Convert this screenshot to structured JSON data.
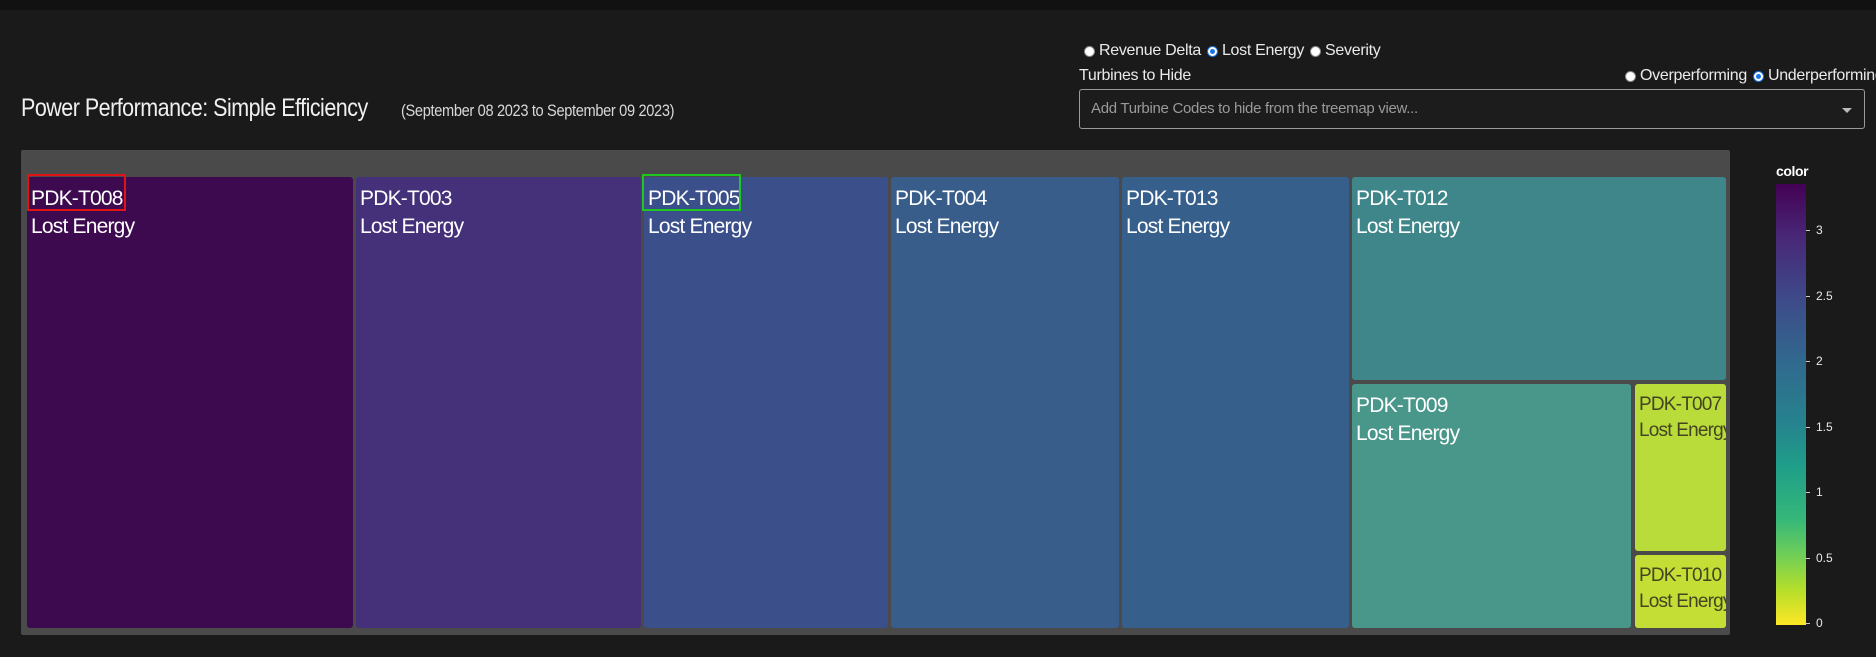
{
  "header": {
    "title": "Power Performance: Simple Efficiency",
    "subtitle": "(September 08 2023 to September 09 2023)"
  },
  "metric_selector": {
    "options": [
      {
        "label": "Revenue Delta",
        "checked": false
      },
      {
        "label": "Lost Energy",
        "checked": true
      },
      {
        "label": "Severity",
        "checked": false
      }
    ]
  },
  "performance_selector": {
    "options": [
      {
        "label": "Overperforming",
        "checked": false
      },
      {
        "label": "Underperforming",
        "checked": true
      }
    ]
  },
  "hide_turbines": {
    "label": "Turbines to Hide",
    "placeholder": "Add Turbine Codes to hide from the treemap view..."
  },
  "treemap": {
    "tiles": [
      {
        "name": "PDK-T008",
        "metric": "Lost Energy",
        "color": "#3d0a50"
      },
      {
        "name": "PDK-T003",
        "metric": "Lost Energy",
        "color": "#45307a"
      },
      {
        "name": "PDK-T005",
        "metric": "Lost Energy",
        "color": "#3b4f8b"
      },
      {
        "name": "PDK-T004",
        "metric": "Lost Energy",
        "color": "#385d8a"
      },
      {
        "name": "PDK-T013",
        "metric": "Lost Energy",
        "color": "#375f8b"
      },
      {
        "name": "PDK-T012",
        "metric": "Lost Energy",
        "color": "#3f868a"
      },
      {
        "name": "PDK-T009",
        "metric": "Lost Energy",
        "color": "#48978a"
      },
      {
        "name": "PDK-T007",
        "metric": "Lost Energy",
        "color": "#b9dc3a"
      },
      {
        "name": "PDK-T010",
        "metric": "Lost Energy",
        "color": "#c5de36"
      }
    ]
  },
  "colorbar": {
    "title": "color",
    "ticks": [
      "3",
      "2.5",
      "2",
      "1.5",
      "1",
      "0.5",
      "0"
    ]
  }
}
